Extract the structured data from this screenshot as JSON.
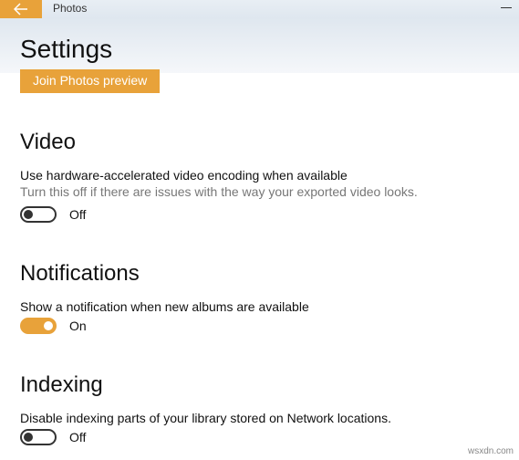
{
  "titlebar": {
    "app_name": "Photos"
  },
  "header": {
    "page_title": "Settings",
    "preview_btn": "Join Photos preview"
  },
  "sections": {
    "video": {
      "title": "Video",
      "label": "Use hardware-accelerated video encoding when available",
      "sub": "Turn this off if there are issues with the way your exported video looks.",
      "state": "Off"
    },
    "notifications": {
      "title": "Notifications",
      "label": "Show a notification when new albums are available",
      "state": "On"
    },
    "indexing": {
      "title": "Indexing",
      "label": "Disable indexing parts of your library stored on Network locations.",
      "state": "Off"
    }
  },
  "watermark": "wsxdn.com"
}
